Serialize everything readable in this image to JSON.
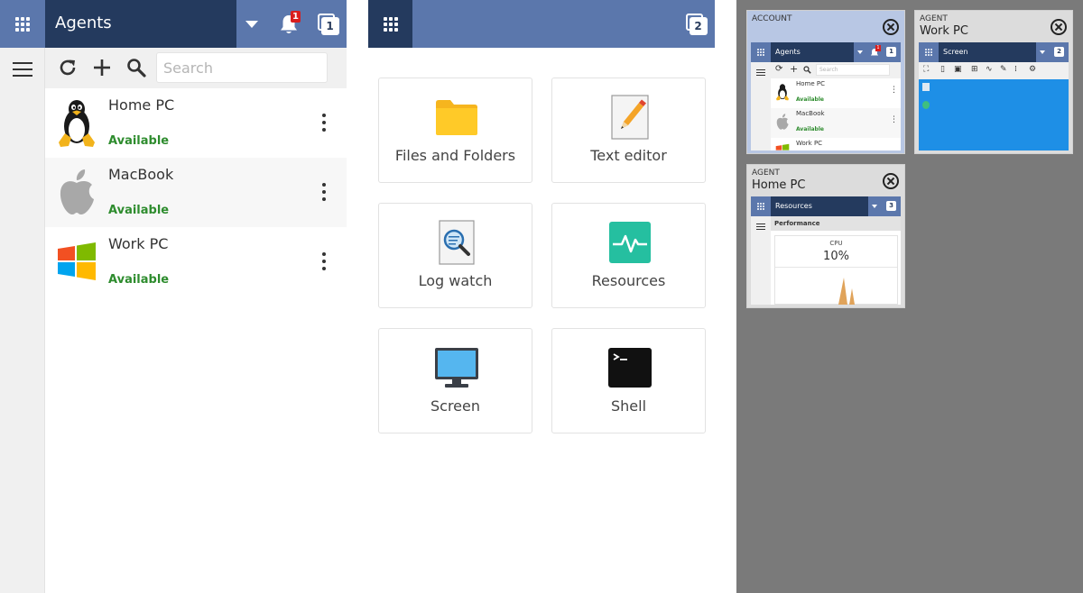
{
  "agents_panel": {
    "title": "Agents",
    "notifications_count": "1",
    "windows_count": "1",
    "search_placeholder": "Search",
    "agents": [
      {
        "name": "Home PC",
        "status": "Available",
        "os_icon": "linux-icon"
      },
      {
        "name": "MacBook",
        "status": "Available",
        "os_icon": "apple-icon"
      },
      {
        "name": "Work PC",
        "status": "Available",
        "os_icon": "windows-icon"
      }
    ]
  },
  "tools_panel": {
    "windows_count": "2",
    "tools": [
      {
        "label": "Files and Folders",
        "icon": "folder-icon"
      },
      {
        "label": "Text editor",
        "icon": "text-editor-icon"
      },
      {
        "label": "Log watch",
        "icon": "log-watch-icon"
      },
      {
        "label": "Resources",
        "icon": "resources-icon"
      },
      {
        "label": "Screen",
        "icon": "monitor-icon"
      },
      {
        "label": "Shell",
        "icon": "terminal-icon"
      }
    ]
  },
  "switcher": {
    "cards": [
      {
        "type": "ACCOUNT",
        "title": "",
        "mini_title": "Agents",
        "notif": "1",
        "windows": "1",
        "search_placeholder": "Search",
        "agents": [
          {
            "name": "Home PC",
            "status": "Available"
          },
          {
            "name": "MacBook",
            "status": "Available"
          },
          {
            "name": "Work PC",
            "status": ""
          }
        ]
      },
      {
        "type": "AGENT",
        "title": "Work PC",
        "mini_title": "Screen",
        "windows": "2"
      },
      {
        "type": "AGENT",
        "title": "Home PC",
        "mini_title": "Resources",
        "windows": "3",
        "section": "Performance",
        "metric_label": "CPU",
        "metric_value": "10%"
      }
    ]
  },
  "colors": {
    "header_blue": "#5b77ac",
    "header_dark": "#243a5e",
    "available_green": "#2e8c2e",
    "badge_red": "#d91d1d",
    "switcher_bg": "#7a7a7a"
  }
}
